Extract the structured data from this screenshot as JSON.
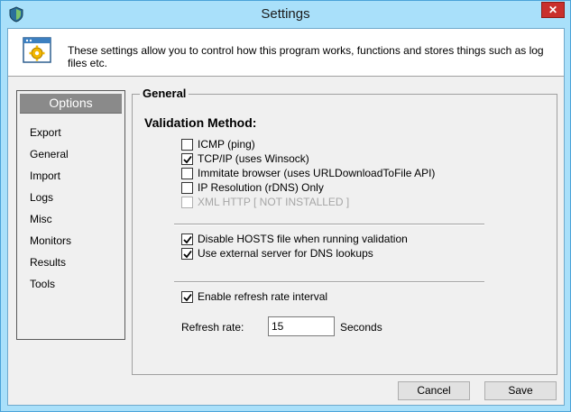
{
  "window": {
    "title": "Settings",
    "close_glyph": "✕"
  },
  "banner": {
    "text": "These settings allow you to control how this program works, functions and stores things such as log files etc."
  },
  "options": {
    "header": "Options",
    "items": [
      "Export",
      "General",
      "Import",
      "Logs",
      "Misc",
      "Monitors",
      "Results",
      "Tools"
    ]
  },
  "general": {
    "group_title": "General",
    "section_title": "Validation Method:",
    "methods": [
      {
        "label": "ICMP (ping)",
        "checked": false,
        "enabled": true
      },
      {
        "label": "TCP/IP (uses Winsock)",
        "checked": true,
        "enabled": true
      },
      {
        "label": "Immitate browser (uses URLDownloadToFile API)",
        "checked": false,
        "enabled": true
      },
      {
        "label": "IP Resolution (rDNS) Only",
        "checked": false,
        "enabled": true
      },
      {
        "label": "XML HTTP [ NOT INSTALLED ]",
        "checked": false,
        "enabled": false
      }
    ],
    "hosts_options": [
      {
        "label": "Disable HOSTS file when running validation",
        "checked": true
      },
      {
        "label": "Use external server for  DNS lookups",
        "checked": true
      }
    ],
    "refresh": {
      "enable_label": "Enable refresh rate interval",
      "enabled": true,
      "rate_label": "Refresh rate:",
      "rate_value": "15",
      "unit": "Seconds"
    }
  },
  "buttons": {
    "cancel": "Cancel",
    "save": "Save"
  },
  "icons": {
    "app": "shield-icon",
    "banner": "settings-window-icon",
    "close": "close-icon"
  }
}
